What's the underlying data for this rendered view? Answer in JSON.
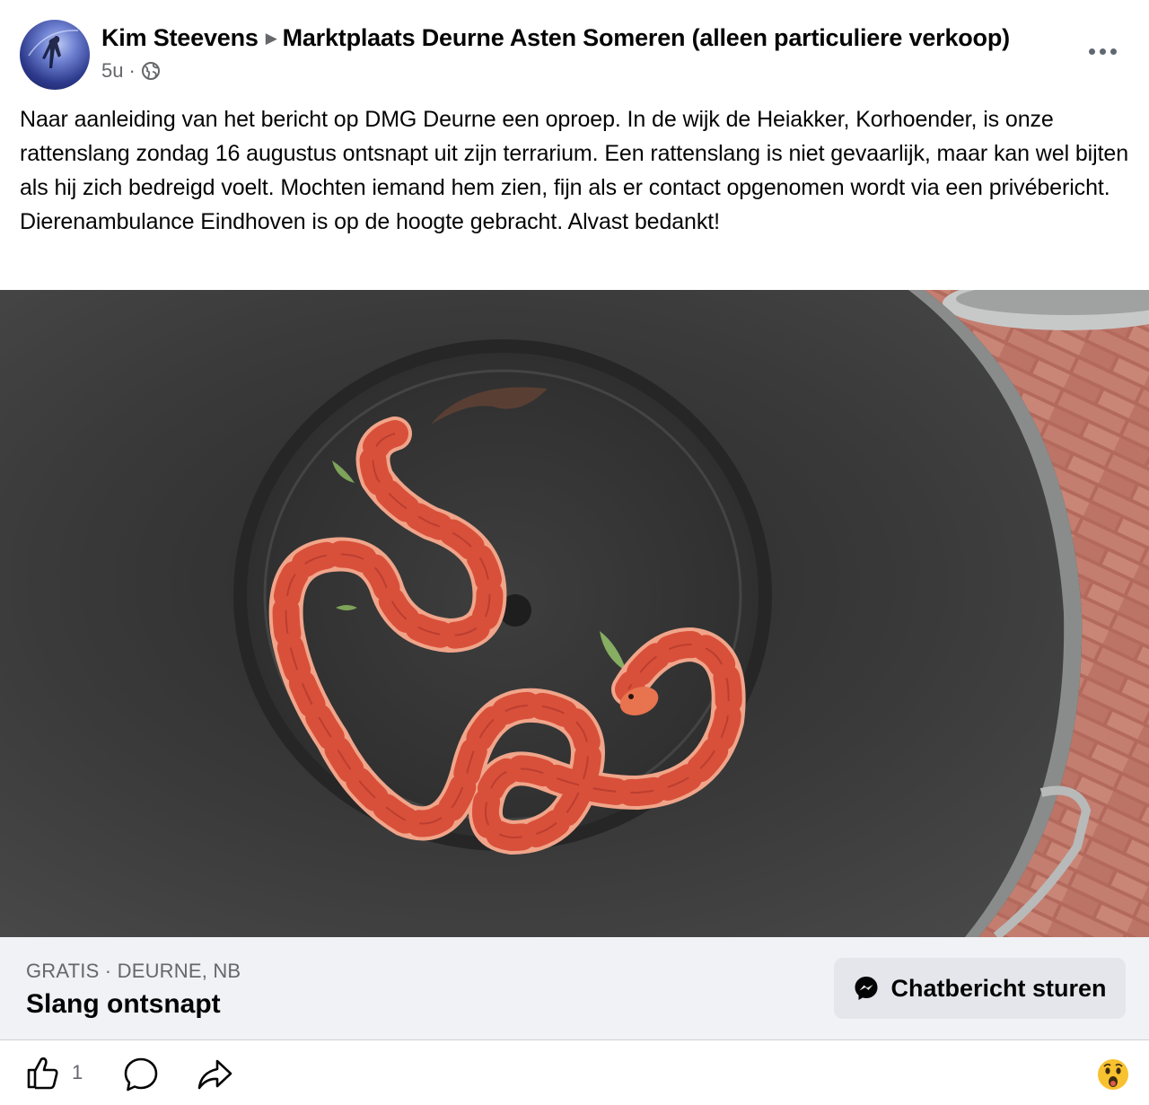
{
  "post": {
    "author": "Kim Steevens",
    "group": "Marktplaats Deurne Asten Someren (alleen particuliere verkoop)",
    "time": "5u",
    "separator": "·",
    "text": "Naar aanleiding van het bericht op DMG Deurne een oproep. In de wijk de Heiakker, Korhoender, is onze rattenslang zondag 16 augustus ontsnapt uit zijn terrarium. Een rattenslang is niet gevaarlijk, maar kan wel bijten als hij zich bedreigd voelt. Mochten iemand hem zien, fijn als er contact opgenomen wordt via een privébericht.  Dierenambulance Eindhoven is op de hoogte gebracht. Alvast bedankt!"
  },
  "listing": {
    "meta": "GRATIS · DEURNE, NB",
    "title": "Slang ontsnapt",
    "chat_label": "Chatbericht sturen"
  },
  "actions": {
    "like_count": "1"
  },
  "icons": {
    "audience": "globe-icon",
    "more": "more-icon",
    "chat": "messenger-icon",
    "like": "thumbs-up-icon",
    "comment": "comment-icon",
    "share": "share-icon",
    "reaction": "wow-emoji-icon"
  },
  "colors": {
    "secondary_text": "#65676b",
    "listing_bg": "#f0f2f5",
    "button_bg": "#e4e6eb"
  }
}
